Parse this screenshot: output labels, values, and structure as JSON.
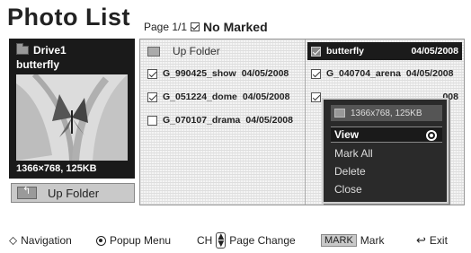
{
  "header": {
    "title": "Photo List",
    "page_info": "Page 1/1",
    "marked_status": "No Marked"
  },
  "preview": {
    "drive_label": "Drive1",
    "file_name": "butterfly",
    "resolution": "1366×768, 125KB"
  },
  "left_button": {
    "label": "Up Folder"
  },
  "grid": {
    "up_folder_label": "Up Folder",
    "items": [
      {
        "name": "butterfly",
        "date": "04/05/2008",
        "checked": true,
        "selected": true
      },
      {
        "name": "G_990425_show",
        "date": "04/05/2008",
        "checked": true
      },
      {
        "name": "G_040704_arena",
        "date": "04/05/2008",
        "checked": true
      },
      {
        "name": "G_051224_dome",
        "date": "04/05/2008",
        "checked": true
      },
      {
        "name": "008",
        "date": "",
        "checked": true
      },
      {
        "name": "G_070107_drama",
        "date": "04/05/2008",
        "checked": false
      }
    ]
  },
  "popup": {
    "info": "1366x768, 125KB",
    "items": [
      "View",
      "Mark All",
      "Delete",
      "Close"
    ],
    "active_item": "View"
  },
  "footer": {
    "navigation": "Navigation",
    "popup_menu": "Popup Menu",
    "ch_label": "CH",
    "page_change": "Page Change",
    "mark_key": "MARK",
    "mark": "Mark",
    "exit": "Exit"
  }
}
